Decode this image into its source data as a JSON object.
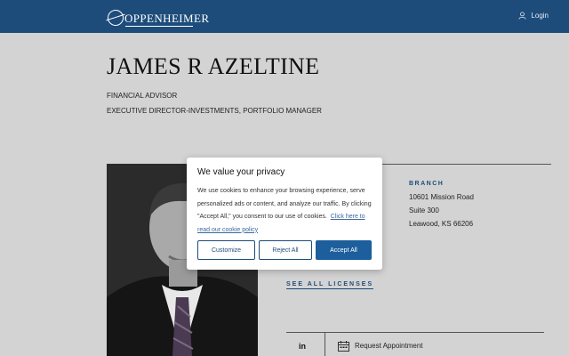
{
  "header": {
    "brand": "OPPENHEIMER",
    "login_label": "Login"
  },
  "advisor": {
    "name": "JAMES R AZELTINE",
    "title_1": "FINANCIAL ADVISOR",
    "title_2": "EXECUTIVE DIRECTOR-INVESTMENTS, PORTFOLIO MANAGER"
  },
  "branch": {
    "heading": "BRANCH",
    "address_1": "10601 Mission Road",
    "address_2": "Suite 300",
    "city_state_zip": "Leawood, KS 66206"
  },
  "licenses_link": "SEE ALL LICENSES",
  "actions": {
    "linkedin": "in",
    "request_appointment": "Request Appointment"
  },
  "cookie_modal": {
    "title": "We value your privacy",
    "body": "We use cookies to enhance your browsing experience, serve personalized ads or content, and analyze our traffic. By clicking \"Accept All,\" you consent to our use of cookies.",
    "policy_link": "Click here to read our cookie policy",
    "customize": "Customize",
    "reject": "Reject All",
    "accept": "Accept All"
  },
  "icons": {
    "login": "user-icon",
    "linkedin": "linkedin-icon",
    "calendar": "calendar-icon"
  },
  "colors": {
    "header_bg": "#1d4c7b",
    "accent": "#1d5e9c",
    "page_bg_dimmed": "#d3d3d3"
  }
}
